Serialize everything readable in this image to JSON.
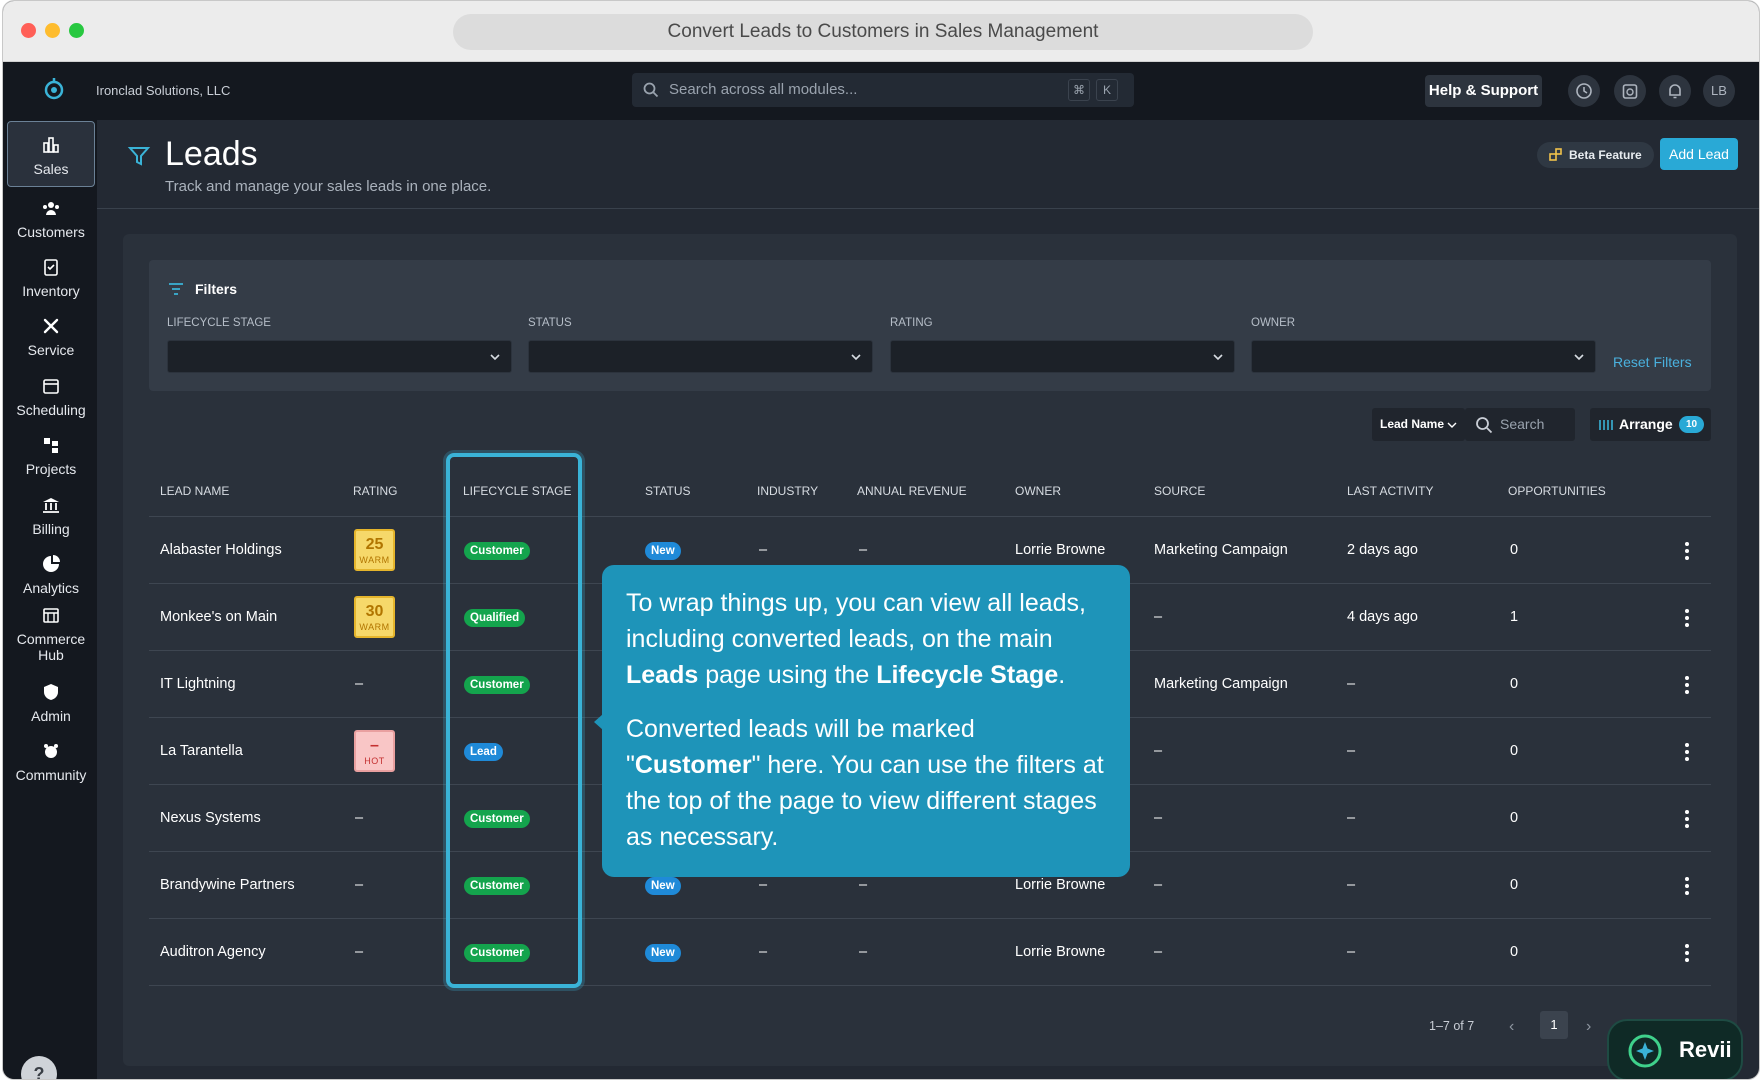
{
  "window": {
    "title": "Convert Leads to Customers in Sales Management"
  },
  "topbar": {
    "company": "Ironclad Solutions, LLC",
    "search_placeholder": "Search across all modules...",
    "kbd_cmd": "⌘",
    "kbd_k": "K",
    "help_label": "Help & Support",
    "avatar_initials": "LB"
  },
  "sidebar": {
    "items": [
      {
        "label": "Sales",
        "icon": "bar-chart-icon"
      },
      {
        "label": "Customers",
        "icon": "people-icon"
      },
      {
        "label": "Inventory",
        "icon": "clipboard-check-icon"
      },
      {
        "label": "Service",
        "icon": "tools-icon"
      },
      {
        "label": "Scheduling",
        "icon": "calendar-icon"
      },
      {
        "label": "Projects",
        "icon": "hierarchy-icon"
      },
      {
        "label": "Billing",
        "icon": "bank-icon"
      },
      {
        "label": "Analytics",
        "icon": "pie-chart-icon"
      },
      {
        "label": "Commerce Hub",
        "icon": "store-icon"
      },
      {
        "label": "Admin",
        "icon": "shield-user-icon"
      },
      {
        "label": "Community",
        "icon": "community-icon"
      }
    ],
    "help_label": "?"
  },
  "header": {
    "title": "Leads",
    "subtitle": "Track and manage your sales leads in one place.",
    "beta_label": "Beta Feature",
    "add_label": "Add Lead"
  },
  "filters": {
    "title": "Filters",
    "labels": [
      "LIFECYCLE STAGE",
      "STATUS",
      "RATING",
      "OWNER"
    ],
    "reset_label": "Reset Filters"
  },
  "table_controls": {
    "sort_label": "Lead Name",
    "search_placeholder": "Search",
    "arrange_label": "Arrange",
    "arrange_count": "10"
  },
  "table": {
    "columns": [
      "LEAD NAME",
      "RATING",
      "LIFECYCLE STAGE",
      "STATUS",
      "INDUSTRY",
      "ANNUAL REVENUE",
      "OWNER",
      "SOURCE",
      "LAST ACTIVITY",
      "OPPORTUNITIES"
    ],
    "rows": [
      {
        "name": "Alabaster Holdings",
        "rating_num": "25",
        "rating_label": "WARM",
        "stage": "Customer",
        "status": "New",
        "industry": "–",
        "revenue": "–",
        "owner": "Lorrie Browne",
        "source": "Marketing Campaign",
        "last_activity": "2 days ago",
        "opportunities": "0"
      },
      {
        "name": "Monkee's on Main",
        "rating_num": "30",
        "rating_label": "WARM",
        "stage": "Qualified",
        "status": "",
        "industry": "",
        "revenue": "",
        "owner": "",
        "source": "–",
        "last_activity": "4 days ago",
        "opportunities": "1"
      },
      {
        "name": "IT Lightning",
        "rating": "–",
        "stage": "Customer",
        "status": "",
        "industry": "",
        "revenue": "",
        "owner": "",
        "source": "Marketing Campaign",
        "last_activity": "–",
        "opportunities": "0"
      },
      {
        "name": "La Tarantella",
        "rating_num": "–",
        "rating_label": "HOT",
        "stage": "Lead",
        "status": "",
        "industry": "",
        "revenue": "",
        "owner": "",
        "source": "–",
        "last_activity": "–",
        "opportunities": "0"
      },
      {
        "name": "Nexus Systems",
        "rating": "–",
        "stage": "Customer",
        "status": "",
        "industry": "",
        "revenue": "",
        "owner": "",
        "source": "–",
        "last_activity": "–",
        "opportunities": "0"
      },
      {
        "name": "Brandywine Partners",
        "rating": "–",
        "stage": "Customer",
        "status": "New",
        "industry": "–",
        "revenue": "–",
        "owner": "Lorrie Browne",
        "source": "–",
        "last_activity": "–",
        "opportunities": "0"
      },
      {
        "name": "Auditron Agency",
        "rating": "–",
        "stage": "Customer",
        "status": "New",
        "industry": "–",
        "revenue": "–",
        "owner": "Lorrie Browne",
        "source": "–",
        "last_activity": "–",
        "opportunities": "0"
      }
    ]
  },
  "tooltip": {
    "p1_pre": "To wrap things up, you can view all leads, including converted leads, on the main ",
    "p1_bold1": "Leads",
    "p1_mid": " page using the ",
    "p1_bold2": "Lifecycle Stage",
    "p1_post": ".",
    "p2_pre": "Converted leads will be marked \"",
    "p2_bold": "Customer",
    "p2_post": "\" here. You can use the filters at the top of the page to view different stages as necessary."
  },
  "pagination": {
    "range": "1–7 of 7",
    "page": "1",
    "prev": "‹",
    "next": "›"
  },
  "assistant": {
    "label": "Revii"
  },
  "colors": {
    "accent": "#29a9d6",
    "customer_badge": "#14a44d",
    "lead_badge": "#1f8ad8",
    "tooltip_bg": "#1e94b9"
  }
}
